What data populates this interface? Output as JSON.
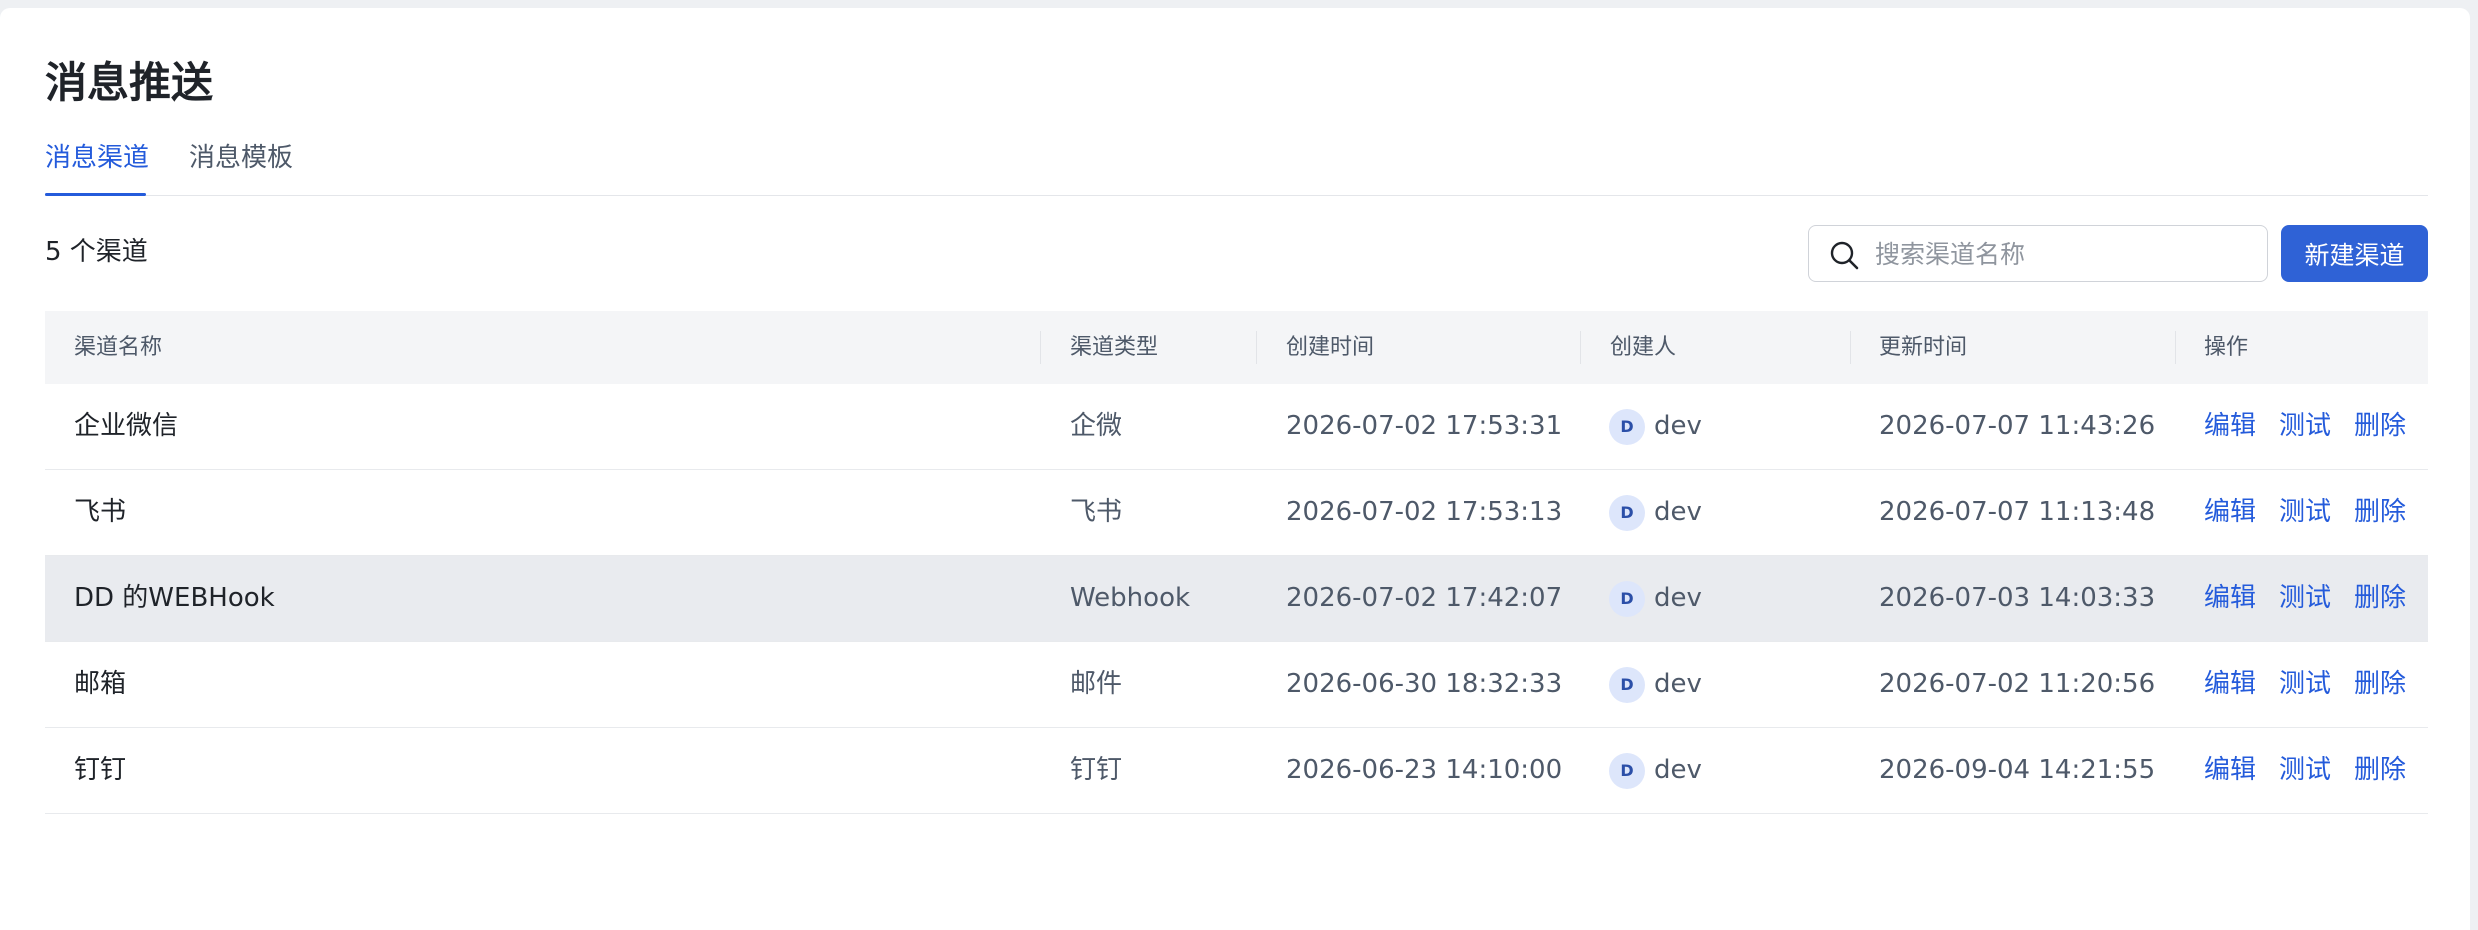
{
  "page": {
    "title": "消息推送"
  },
  "tabs": [
    {
      "label": "消息渠道",
      "active": true
    },
    {
      "label": "消息模板",
      "active": false
    }
  ],
  "toolbar": {
    "count_label": "5 个渠道",
    "search_placeholder": "搜索渠道名称",
    "search_value": "",
    "new_button": "新建渠道"
  },
  "table": {
    "columns": [
      "渠道名称",
      "渠道类型",
      "创建时间",
      "创建人",
      "更新时间",
      "操作"
    ],
    "rows": [
      {
        "name": "企业微信",
        "type": "企微",
        "created": "2026-07-02 17:53:31",
        "creator_initial": "D",
        "creator": "dev",
        "updated": "2026-07-07 11:43:26"
      },
      {
        "name": "飞书",
        "type": "飞书",
        "created": "2026-07-02 17:53:13",
        "creator_initial": "D",
        "creator": "dev",
        "updated": "2026-07-07 11:13:48"
      },
      {
        "name": "DD 的WEBHook",
        "type": "Webhook",
        "created": "2026-07-02 17:42:07",
        "creator_initial": "D",
        "creator": "dev",
        "updated": "2026-07-03 14:03:33",
        "hovered": true
      },
      {
        "name": "邮箱",
        "type": "邮件",
        "created": "2026-06-30 18:32:33",
        "creator_initial": "D",
        "creator": "dev",
        "updated": "2026-07-02 11:20:56"
      },
      {
        "name": "钉钉",
        "type": "钉钉",
        "created": "2026-06-23 14:10:00",
        "creator_initial": "D",
        "creator": "dev",
        "updated": "2026-09-04 14:21:55"
      }
    ],
    "actions": {
      "edit": "编辑",
      "test": "测试",
      "delete": "删除"
    }
  },
  "icons": {
    "search": "search-icon"
  },
  "colors": {
    "accent": "#245bdb",
    "primary_button": "#2f62d6",
    "header_bg": "#f4f5f7",
    "hover_row": "#e9ebef"
  }
}
